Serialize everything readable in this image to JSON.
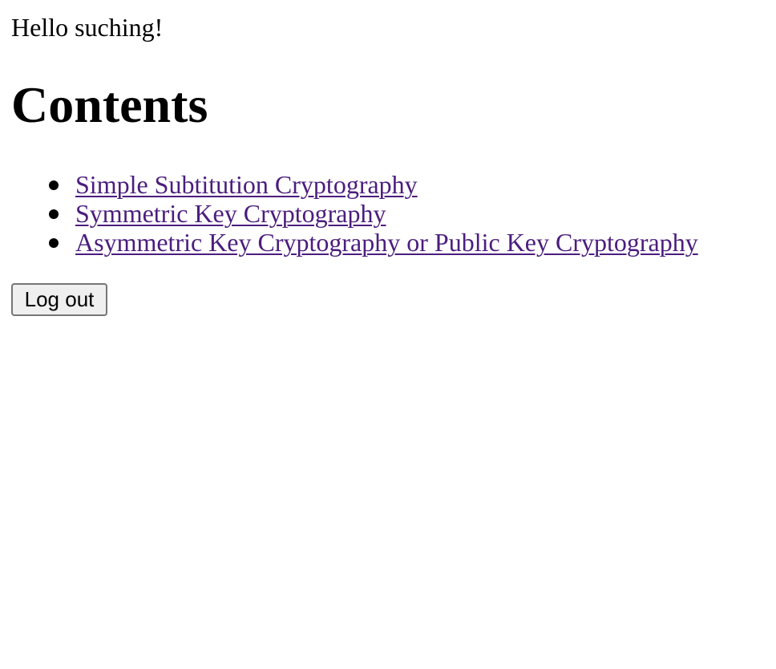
{
  "greeting": "Hello suching!",
  "heading": "Contents",
  "links": [
    "Simple Subtitution Cryptography",
    "Symmetric Key Cryptography",
    "Asymmetric Key Cryptography or Public Key Cryptography"
  ],
  "logout_label": "Log out",
  "colors": {
    "link": "#4b1d7e",
    "text": "#000000",
    "button_bg": "#efefef",
    "button_border": "#767676"
  }
}
